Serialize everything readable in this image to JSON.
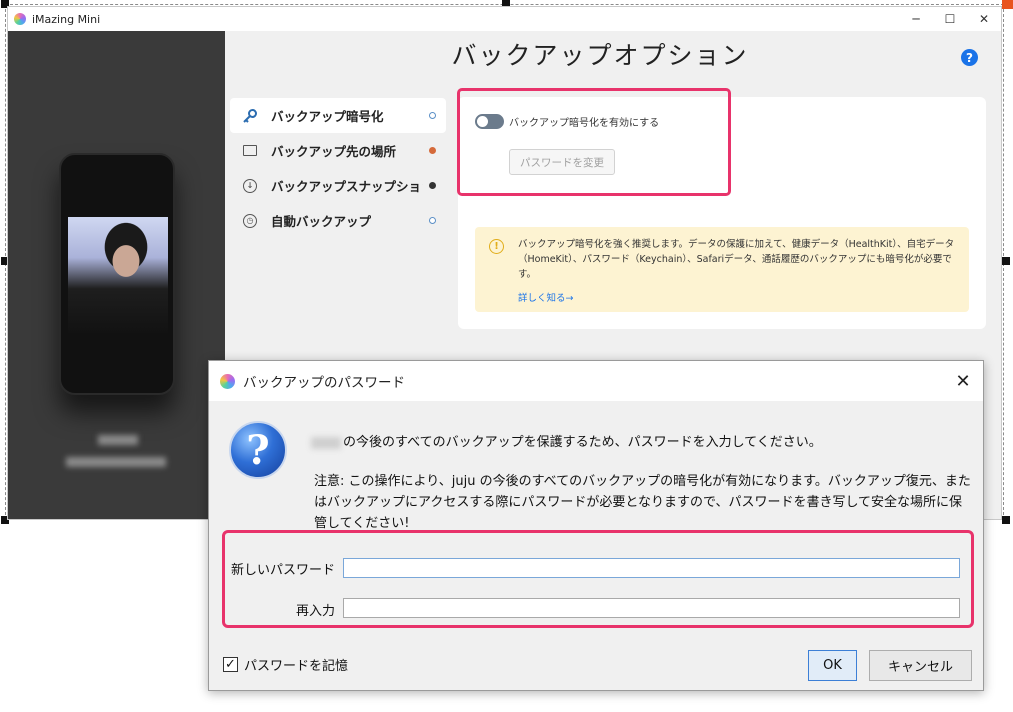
{
  "app": {
    "title": "iMazing Mini",
    "window_controls": {
      "minimize": "─",
      "maximize": "☐",
      "close": "✕"
    }
  },
  "page": {
    "title": "バックアップオプション",
    "help_label": "?"
  },
  "sidebar": {
    "items": [
      {
        "label": "バックアップ暗号化",
        "icon": "key-icon",
        "status": "hollow",
        "active": true
      },
      {
        "label": "バックアップ先の場所",
        "icon": "folder-icon",
        "status": "orange",
        "active": false
      },
      {
        "label": "バックアップスナップショット",
        "icon": "history-icon",
        "status": "dark",
        "active": false
      },
      {
        "label": "自動バックアップ",
        "icon": "clock-icon",
        "status": "hollow",
        "active": false
      }
    ]
  },
  "encryption": {
    "toggle_label": "バックアップ暗号化を有効にする",
    "toggle_on": false,
    "change_password_label": "パスワードを変更"
  },
  "note": {
    "icon": "info-icon",
    "text": "バックアップ暗号化を強く推奨します。データの保護に加えて、健康データ（HealthKit）、自宅データ（HomeKit）、パスワード（Keychain）、Safariデータ、通話履歴のバックアップにも暗号化が必要です。",
    "link": "詳しく知る→"
  },
  "dialog": {
    "title": "バックアップのパスワード",
    "close": "✕",
    "icon": "question-icon",
    "message1": "の今後のすべてのバックアップを保護するため、パスワードを入力してください。",
    "message2": "注意: この操作により、juju の今後のすべてのバックアップの暗号化が有効になります。バックアップ復元、またはバックアップにアクセスする際にパスワードが必要となりますので、パスワードを書き写して安全な場所に保管してください!",
    "new_password_label": "新しいパスワード",
    "new_password_value": "",
    "reenter_label": "再入力",
    "reenter_value": "",
    "remember_label": "パスワードを記憶",
    "remember_checked": true,
    "ok_label": "OK",
    "cancel_label": "キャンセル"
  },
  "colors": {
    "highlight": "#e8336b",
    "accent": "#1a73e8",
    "note_bg": "#fdf3d2",
    "device_panel": "#3a3a3a"
  }
}
